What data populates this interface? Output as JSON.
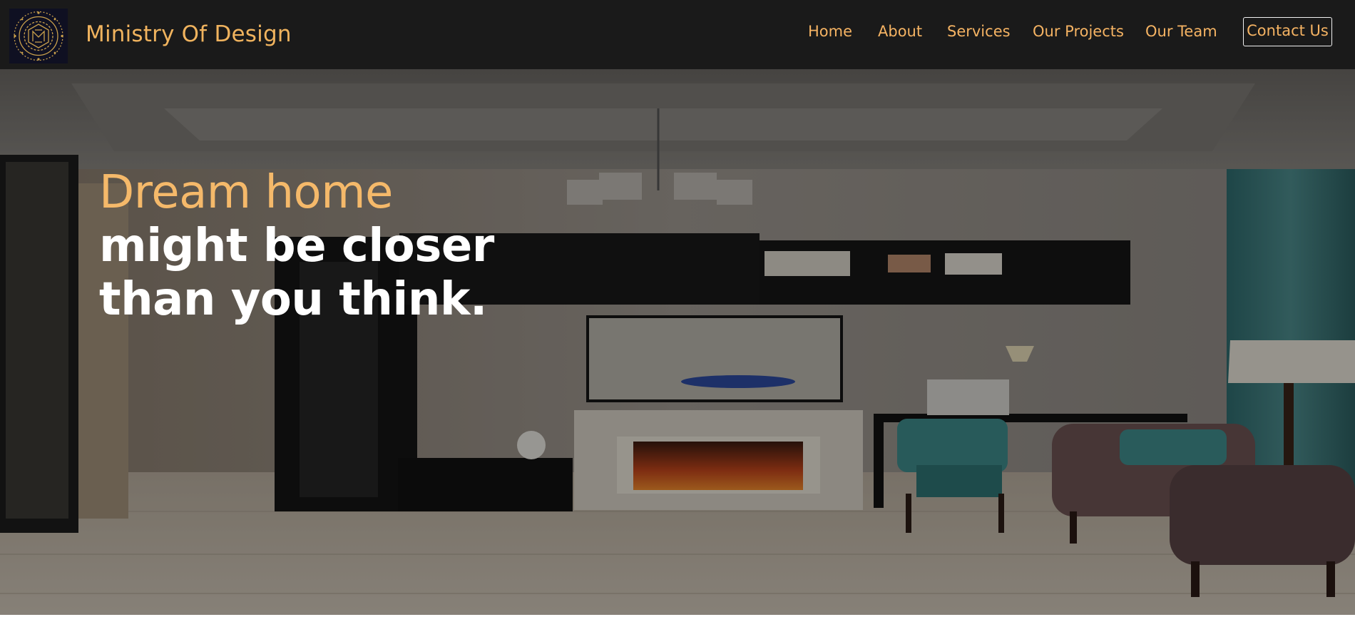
{
  "brand": {
    "name": "Ministry Of Design",
    "logo_icon": "md-monogram-logo-icon"
  },
  "nav": {
    "items": [
      {
        "label": "Home"
      },
      {
        "label": "About"
      },
      {
        "label": "Services"
      },
      {
        "label": "Our Projects"
      },
      {
        "label": "Our Team"
      }
    ],
    "contact_label": "Contact Us"
  },
  "hero": {
    "headline_accent": "Dream home",
    "headline_rest": " might be closer than you think.",
    "background_image": "living-room-interior-photo"
  },
  "colors": {
    "nav_background": "#1a1a1a",
    "accent": "#f5b363",
    "headline_white": "#ffffff"
  }
}
